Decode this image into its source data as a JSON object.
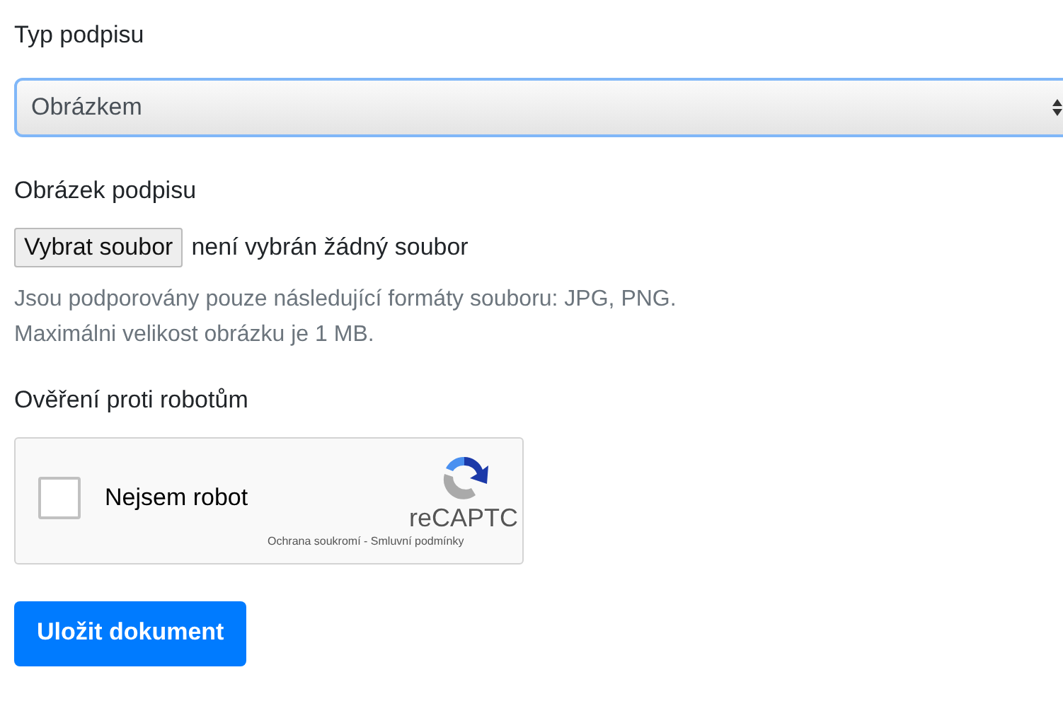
{
  "signature_type": {
    "label": "Typ podpisu",
    "value": "Obrázkem"
  },
  "signature_image": {
    "label": "Obrázek podpisu",
    "button": "Vybrat soubor",
    "status": "není vybrán žádný soubor",
    "help": [
      "Jsou podporovány pouze následující formáty souboru: JPG, PNG.",
      "Maximálni velikost obrázku je 1 MB."
    ]
  },
  "captcha": {
    "label": "Ověření proti robotům",
    "checkbox_label": "Nejsem robot",
    "checked": false,
    "brand": "reCAPTC",
    "footer": "Ochrana soukromí - Smluvní podmínky"
  },
  "submit": "Uložit dokument"
}
